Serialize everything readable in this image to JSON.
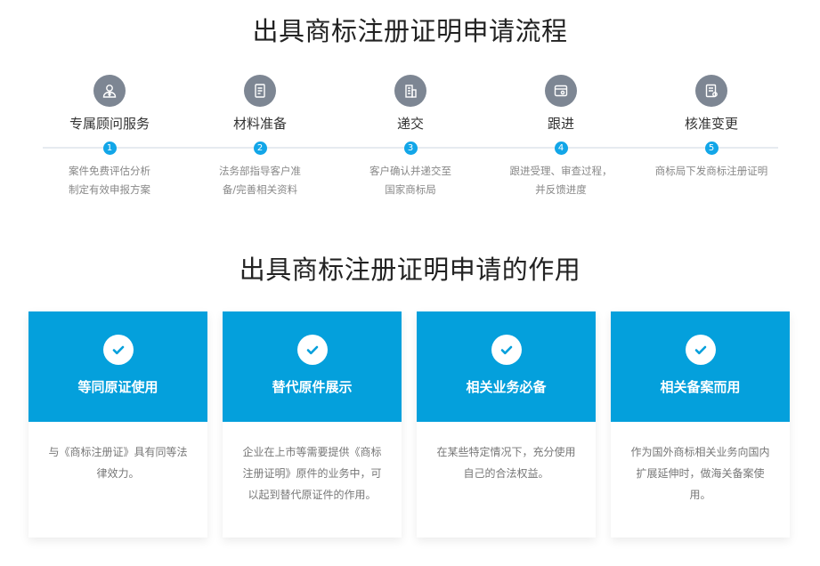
{
  "process": {
    "title": "出具商标注册证明申请流程",
    "steps": [
      {
        "num": "1",
        "name": "专属顾问服务",
        "desc": "案件免费评估分析\n制定有效申报方案",
        "icon": "advisor-icon"
      },
      {
        "num": "2",
        "name": "材料准备",
        "desc": "法务部指导客户准\n备/完善相关资料",
        "icon": "document-icon"
      },
      {
        "num": "3",
        "name": "递交",
        "desc": "客户确认并递交至\n国家商标局",
        "icon": "building-icon"
      },
      {
        "num": "4",
        "name": "跟进",
        "desc": "跟进受理、审查过程，\n并反馈进度",
        "icon": "browser-window-icon"
      },
      {
        "num": "5",
        "name": "核准变更",
        "desc": "商标局下发商标注册证明",
        "icon": "certificate-icon"
      }
    ]
  },
  "function": {
    "title": "出具商标注册证明申请的作用",
    "cards": [
      {
        "title": "等同原证使用",
        "desc": "与《商标注册证》具有同等法\n律效力。"
      },
      {
        "title": "替代原件展示",
        "desc": "企业在上市等需要提供《商标\n注册证明》原件的业务中，可\n以起到替代原证件的作用。"
      },
      {
        "title": "相关业务必备",
        "desc": "在某些特定情况下，充分使用\n自己的合法权益。"
      },
      {
        "title": "相关备案而用",
        "desc": "作为国外商标相关业务向国内\n扩展延伸时，做海关备案使\n用。"
      }
    ]
  },
  "colors": {
    "accent": "#04a0dc",
    "step_icon_bg": "#7d8693",
    "step_number_bg": "#12a6e8"
  }
}
